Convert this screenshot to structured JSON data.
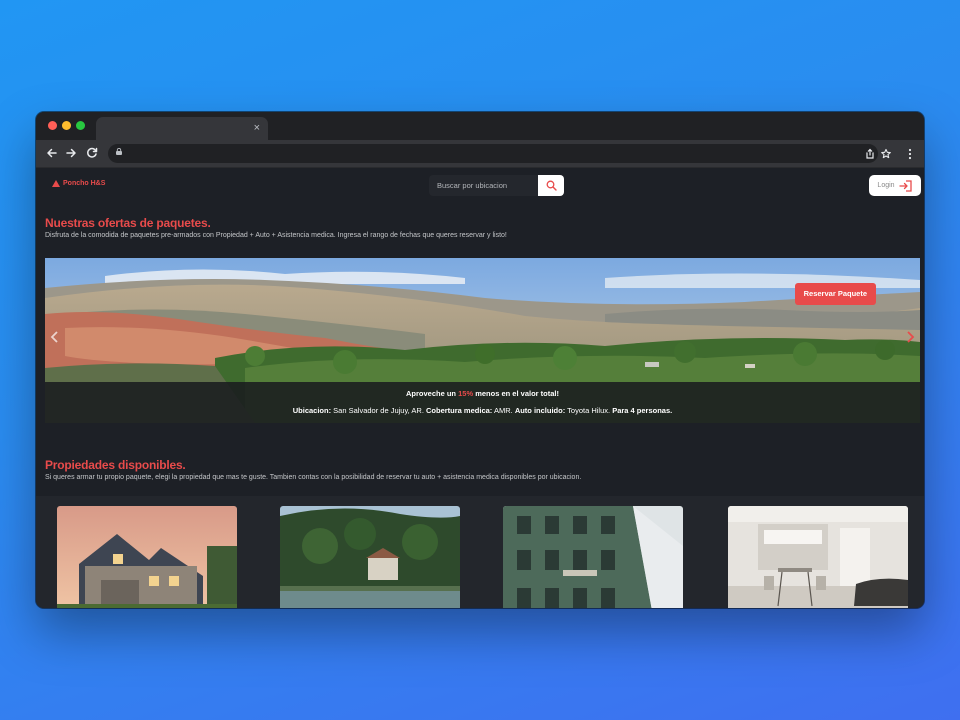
{
  "browser": {
    "tab_close": "×"
  },
  "brand": {
    "name": "Poncho H&S",
    "accent": "#e84b4b"
  },
  "header": {
    "search_placeholder": "Buscar por ubicacion",
    "login_label": "Login"
  },
  "offers": {
    "title": "Nuestras ofertas de paquetes.",
    "subtitle": "Disfruta de la comodida de paquetes pre-armados con Propiedad + Auto + Asistencia medica. Ingresa el rango de fechas que queres reservar y listo!",
    "banner": {
      "button_label": "Reservar Paquete",
      "promo_prefix": "Aproveche un",
      "promo_percent": "15%",
      "promo_suffix": "menos en el valor total!",
      "ubicacion_label": "Ubicacion:",
      "ubicacion_value": "San Salvador de Jujuy, AR.",
      "cobertura_label": "Cobertura medica:",
      "cobertura_value": "AMR.",
      "auto_label": "Auto incluido:",
      "auto_value": "Toyota Hilux.",
      "personas_label": "Para 4 personas."
    }
  },
  "properties": {
    "title": "Propiedades disponibles.",
    "subtitle": "Si queres armar tu propio paquete, elegi la propiedad que mas te guste. Tambien contas con la posibilidad de reservar tu auto + asistencia medica disponibles por ubicacion."
  }
}
